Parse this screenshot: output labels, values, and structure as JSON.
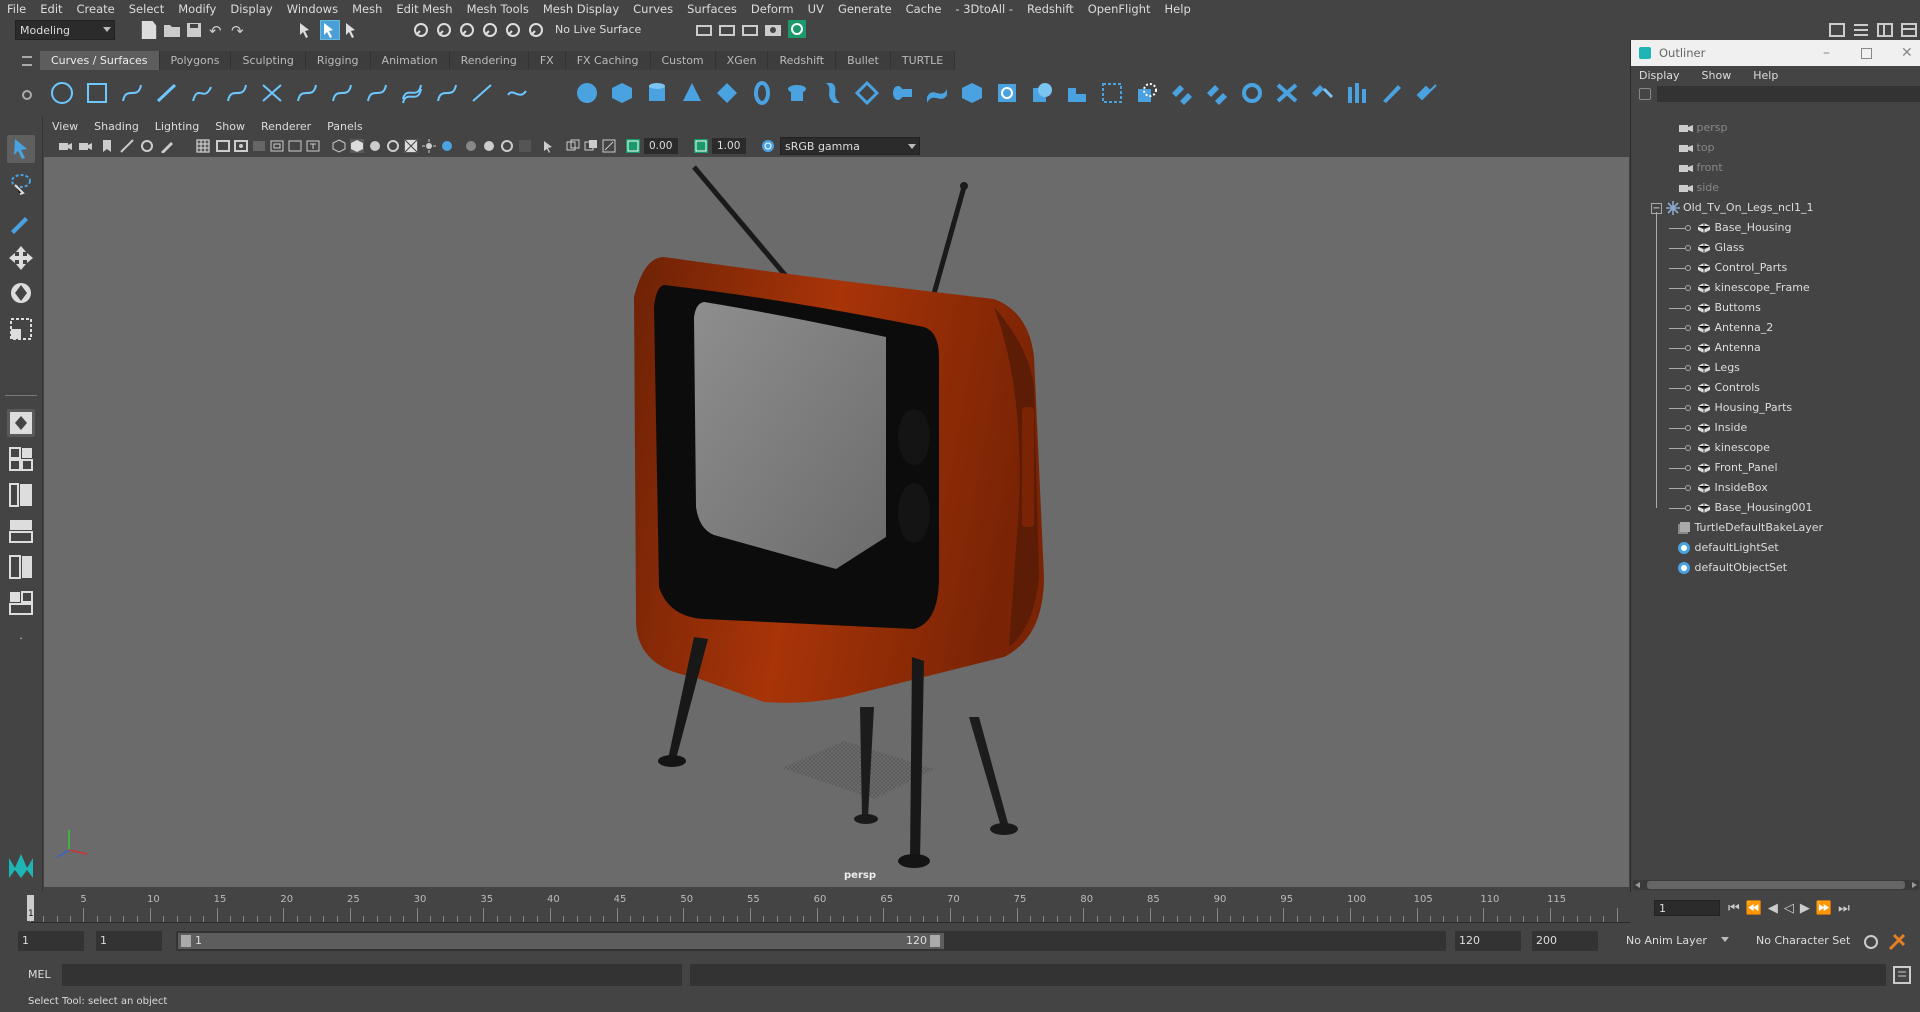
{
  "menubar": [
    "File",
    "Edit",
    "Create",
    "Select",
    "Modify",
    "Display",
    "Windows",
    "Mesh",
    "Edit Mesh",
    "Mesh Tools",
    "Mesh Display",
    "Curves",
    "Surfaces",
    "Deform",
    "UV",
    "Generate",
    "Cache",
    "- 3DtoAll -",
    "Redshift",
    "OpenFlight",
    "Help"
  ],
  "statusline": {
    "mode": "Modeling",
    "live_surface": "No Live Surface"
  },
  "shelf_tabs": [
    "Curves / Surfaces",
    "Polygons",
    "Sculpting",
    "Rigging",
    "Animation",
    "Rendering",
    "FX",
    "FX Caching",
    "Custom",
    "XGen",
    "Redshift",
    "Bullet",
    "TURTLE"
  ],
  "shelf_active": "Curves / Surfaces",
  "viewport": {
    "menu": [
      "View",
      "Shading",
      "Lighting",
      "Show",
      "Renderer",
      "Panels"
    ],
    "exposure": "0.00",
    "gamma": "1.00",
    "colorspace": "sRGB gamma",
    "camera_label": "persp"
  },
  "outliner": {
    "title": "Outliner",
    "menu": [
      "Display",
      "Show",
      "Help"
    ],
    "cameras": [
      "persp",
      "top",
      "front",
      "side"
    ],
    "group": "Old_Tv_On_Legs_ncl1_1",
    "children": [
      "Base_Housing",
      "Glass",
      "Control_Parts",
      "kinescope_Frame",
      "Buttoms",
      "Antenna_2",
      "Antenna",
      "Legs",
      "Controls",
      "Housing_Parts",
      "Inside",
      "kinescope",
      "Front_Panel",
      "InsideBox",
      "Base_Housing001"
    ],
    "sets": [
      "TurtleDefaultBakeLayer",
      "defaultLightSet",
      "defaultObjectSet"
    ]
  },
  "timeline": {
    "ticks": [
      "5",
      "10",
      "15",
      "20",
      "25",
      "30",
      "35",
      "40",
      "45",
      "50",
      "55",
      "60",
      "65",
      "70",
      "75",
      "80",
      "85",
      "90",
      "95",
      "100",
      "105",
      "110",
      "115"
    ],
    "current_marker": "1",
    "current_frame": "1"
  },
  "range": {
    "start": "1",
    "start2": "1",
    "slider_start": "1",
    "slider_end": "120",
    "end": "120",
    "end2": "200",
    "anim_layer": "No Anim Layer",
    "char_set": "No Character Set"
  },
  "cmdline": {
    "label": "MEL"
  },
  "helpline": "Select Tool: select an object",
  "colors": {
    "accent": "#4a9fd8",
    "tv_body": "#a83408",
    "viewport_bg": "#6b6b6b"
  }
}
